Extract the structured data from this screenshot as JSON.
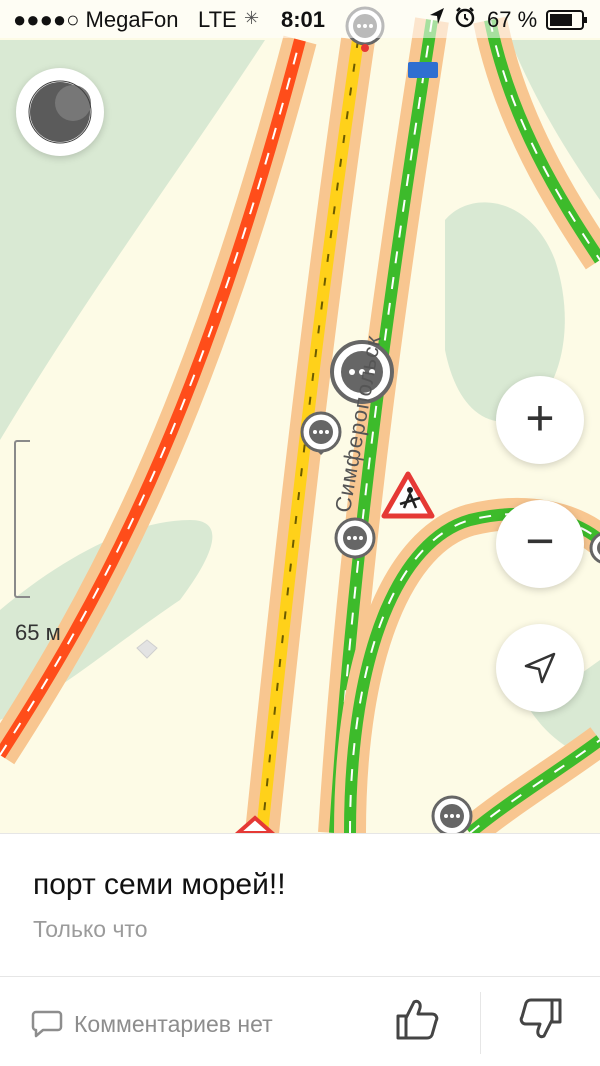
{
  "status_bar": {
    "carrier": "●●●●○ MegaFon",
    "network": "LTE",
    "time": "8:01",
    "battery": "67 %"
  },
  "map": {
    "scale_label": "65 м",
    "street_label": "Симферопольск",
    "controls": {
      "zoom_in": "+",
      "zoom_out": "−"
    },
    "colors": {
      "road_red": "#ff4d1a",
      "road_yellow": "#ffd11a",
      "road_green": "#3dbb2b",
      "road_casing": "#f8c690",
      "park": "#d9e9d3",
      "background": "#fdfbe6"
    }
  },
  "message": {
    "title": "порт семи морей!!",
    "time": "Только что"
  },
  "footer": {
    "comments_label": "Комментариев нет"
  },
  "icons": [
    "signal-icon",
    "location-arrow-icon",
    "alarm-icon",
    "battery-icon",
    "chat-bubble-icon",
    "roadwork-icon",
    "thumbs-up-icon",
    "thumbs-down-icon",
    "navigation-icon"
  ]
}
